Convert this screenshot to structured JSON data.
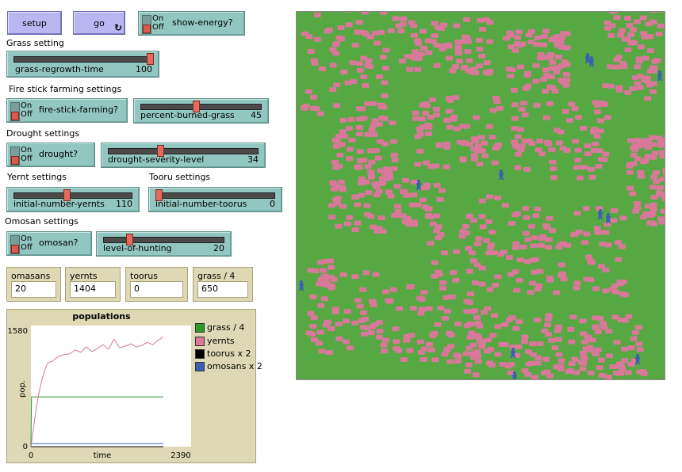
{
  "buttons": {
    "setup": "setup",
    "go": "go",
    "go_icon": "↻"
  },
  "switches": {
    "show_energy": {
      "on": "On",
      "off": "Off",
      "label": "show-energy?"
    },
    "fire_stick": {
      "on": "On",
      "off": "Off",
      "label": "fire-stick-farming?"
    },
    "drought": {
      "on": "On",
      "off": "Off",
      "label": "drought?"
    },
    "omosan": {
      "on": "On",
      "off": "Off",
      "label": "omosan?"
    }
  },
  "sections": {
    "grass": "Grass setting",
    "fire": "Fire stick farming settings",
    "drought": "Drought settings",
    "yernt": "Yernt settings",
    "tooru": "Tooru settings",
    "omosan": "Omosan settings"
  },
  "sliders": {
    "grass_regrowth": {
      "label": "grass-regrowth-time",
      "value": "100",
      "fraction": 1.0
    },
    "percent_burned": {
      "label": "percent-burned-grass",
      "value": "45",
      "fraction": 0.45
    },
    "drought_severity": {
      "label": "drought-severity-level",
      "value": "34",
      "fraction": 0.34
    },
    "initial_yernts": {
      "label": "initial-number-yernts",
      "value": "110",
      "fraction": 0.44
    },
    "initial_toorus": {
      "label": "initial-number-toorus",
      "value": "0",
      "fraction": 0.0
    },
    "hunting": {
      "label": "level-of-hunting",
      "value": "20",
      "fraction": 0.2
    }
  },
  "monitors": [
    {
      "label": "omasans",
      "value": "20"
    },
    {
      "label": "yernts",
      "value": "1404"
    },
    {
      "label": "toorus",
      "value": "0"
    },
    {
      "label": "grass / 4",
      "value": "650"
    }
  ],
  "chart_data": {
    "type": "line",
    "title": "populations",
    "xlabel": "time",
    "ylabel": "pop.",
    "xlim": [
      0,
      2390
    ],
    "ylim": [
      0,
      1580
    ],
    "tick_labels": {
      "x_min": "0",
      "x_max": "2390",
      "y_min": "0",
      "y_max": "1580"
    },
    "series": [
      {
        "name": "grass / 4",
        "color": "#2e9a2e",
        "x": [
          0,
          10,
          20,
          2390
        ],
        "y": [
          0,
          650,
          650,
          650
        ]
      },
      {
        "name": "yernts",
        "color": "#d9789a",
        "x": [
          0,
          50,
          100,
          150,
          200,
          250,
          300,
          400,
          500,
          600,
          700,
          800,
          900,
          1000,
          1100,
          1200,
          1300,
          1400,
          1500,
          1600,
          1700,
          1800,
          1900,
          2000,
          2100,
          2200,
          2300,
          2390
        ],
        "y": [
          0,
          260,
          520,
          720,
          880,
          1000,
          1090,
          1120,
          1180,
          1200,
          1210,
          1260,
          1230,
          1300,
          1240,
          1280,
          1330,
          1270,
          1400,
          1290,
          1310,
          1340,
          1300,
          1320,
          1360,
          1330,
          1390,
          1430
        ]
      },
      {
        "name": "toorus x 2",
        "color": "#000000",
        "x": [
          0,
          2390
        ],
        "y": [
          0,
          0
        ]
      },
      {
        "name": "omosans x 2",
        "color": "#3b5fb5",
        "x": [
          0,
          2390
        ],
        "y": [
          40,
          40
        ]
      }
    ]
  },
  "world": {
    "grass_color": "#56a843",
    "yernt_color": "#d9789a",
    "omosan_color": "#3b5fb5",
    "omosan_icon": "person-icon"
  }
}
